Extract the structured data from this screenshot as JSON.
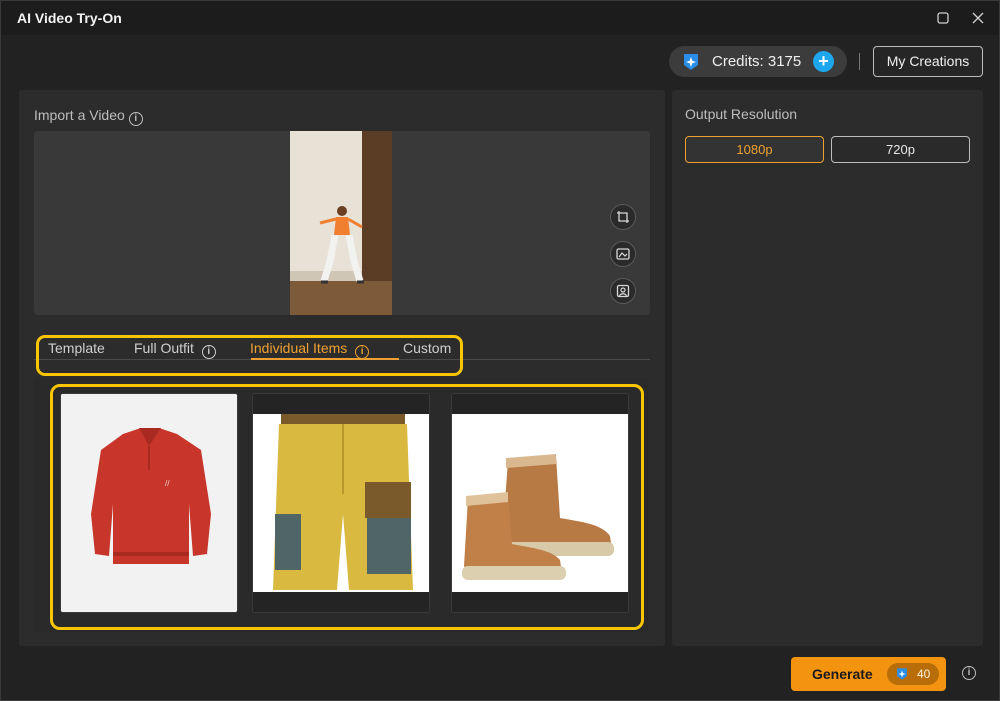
{
  "window": {
    "title": "AI Video Try-On"
  },
  "header": {
    "credits_label": "Credits: 3175",
    "my_creations_label": "My Creations"
  },
  "import": {
    "label": "Import a Video"
  },
  "tabs": [
    {
      "label": "Template"
    },
    {
      "label": "Full Outfit"
    },
    {
      "label": "Individual Items",
      "active": true
    },
    {
      "label": "Custom"
    }
  ],
  "items": [
    {
      "icon": "red-sweatshirt-image"
    },
    {
      "icon": "yellow-cargo-shorts-image"
    },
    {
      "icon": "brown-ankle-boots-image"
    }
  ],
  "output": {
    "label": "Output Resolution",
    "options": [
      {
        "label": "1080p",
        "selected": true
      },
      {
        "label": "720p",
        "selected": false
      }
    ]
  },
  "generate": {
    "label": "Generate",
    "cost": "40"
  },
  "colors": {
    "accent": "#f39410",
    "highlight": "#f7c600",
    "credit_plus": "#1ea7ef"
  }
}
